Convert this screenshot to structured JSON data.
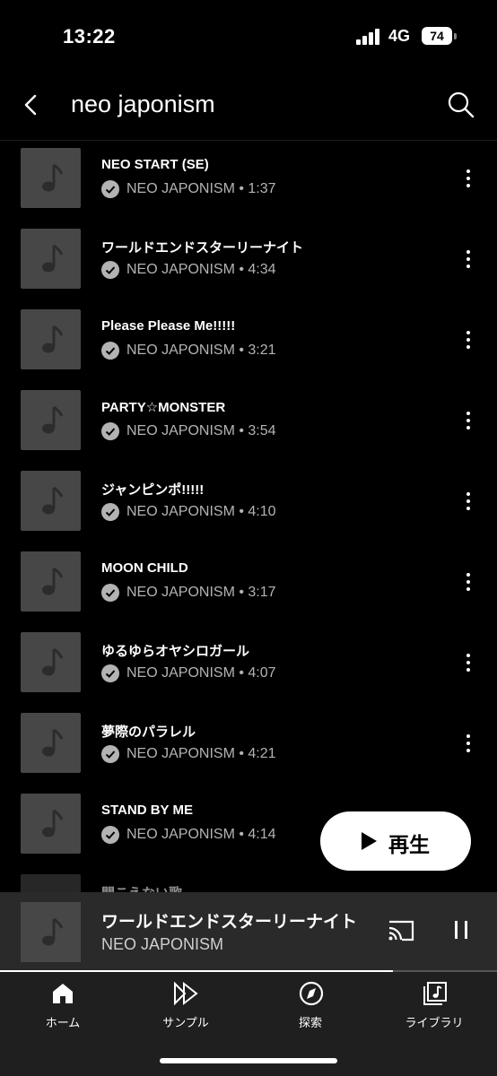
{
  "status": {
    "time": "13:22",
    "network": "4G",
    "battery": "74"
  },
  "header": {
    "title": "neo japonism"
  },
  "tracks": [
    {
      "title": "NEO START (SE)",
      "artist": "NEO JAPONISM",
      "duration": "1:37"
    },
    {
      "title": "ワールドエンドスターリーナイト",
      "artist": "NEO JAPONISM",
      "duration": "4:34"
    },
    {
      "title": "Please Please Me!!!!!",
      "artist": "NEO JAPONISM",
      "duration": "3:21"
    },
    {
      "title": "PARTY☆MONSTER",
      "artist": "NEO JAPONISM",
      "duration": "3:54"
    },
    {
      "title": "ジャンピンポ!!!!!",
      "artist": "NEO JAPONISM",
      "duration": "4:10"
    },
    {
      "title": "MOON CHILD",
      "artist": "NEO JAPONISM",
      "duration": "3:17"
    },
    {
      "title": "ゆるゆらオヤシロガール",
      "artist": "NEO JAPONISM",
      "duration": "4:07"
    },
    {
      "title": "夢際のパラレル",
      "artist": "NEO JAPONISM",
      "duration": "4:21"
    },
    {
      "title": "STAND BY ME",
      "artist": "NEO JAPONISM",
      "duration": "4:14"
    },
    {
      "title": "聞こえない歌"
    }
  ],
  "play_button": {
    "label": "再生"
  },
  "now_playing": {
    "title": "ワールドエンドスターリーナイト",
    "artist": "NEO JAPONISM",
    "progress": 0.79
  },
  "nav": [
    {
      "label": "ホーム",
      "icon": "home-icon"
    },
    {
      "label": "サンプル",
      "icon": "samples-icon"
    },
    {
      "label": "探索",
      "icon": "explore-icon"
    },
    {
      "label": "ライブラリ",
      "icon": "library-icon"
    }
  ]
}
